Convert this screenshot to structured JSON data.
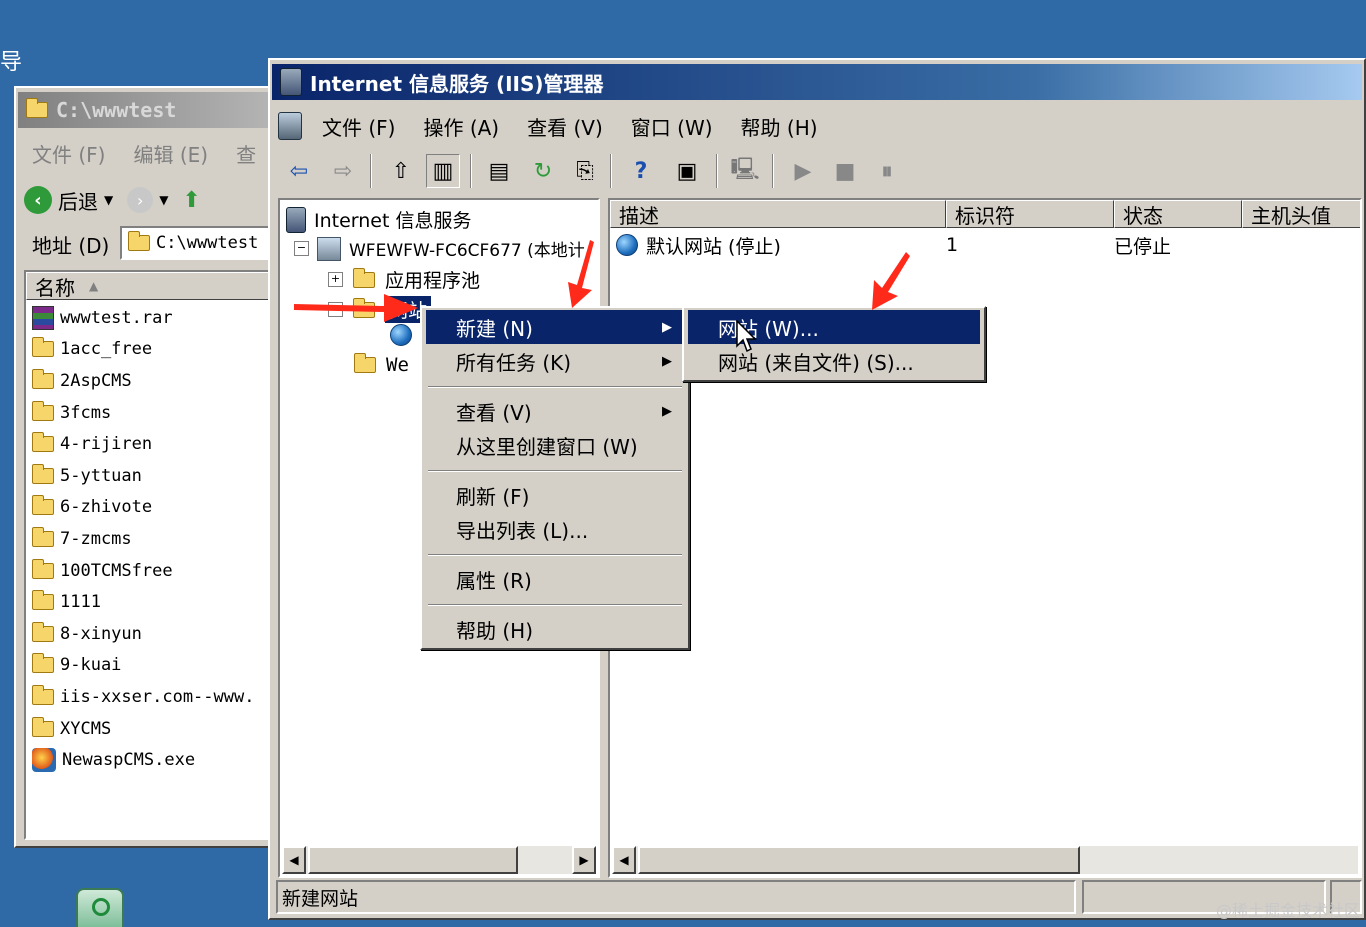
{
  "desktop": {
    "left_edge_text": "导"
  },
  "explorer": {
    "title": "C:\\wwwtest",
    "menu": [
      "文件 (F)",
      "编辑 (E)",
      "查"
    ],
    "back_label": "后退",
    "address_label": "地址 (D)",
    "address_value": "C:\\wwwtest",
    "column_name": "名称",
    "files": [
      {
        "name": "wwwtest.rar",
        "type": "rar"
      },
      {
        "name": "1acc_free",
        "type": "folder"
      },
      {
        "name": "2AspCMS",
        "type": "folder"
      },
      {
        "name": "3fcms",
        "type": "folder"
      },
      {
        "name": "4-rijiren",
        "type": "folder"
      },
      {
        "name": "5-yttuan",
        "type": "folder"
      },
      {
        "name": "6-zhivote",
        "type": "folder"
      },
      {
        "name": "7-zmcms",
        "type": "folder"
      },
      {
        "name": "100TCMSfree",
        "type": "folder"
      },
      {
        "name": "1111",
        "type": "folder"
      },
      {
        "name": "8-xinyun",
        "type": "folder"
      },
      {
        "name": "9-kuai",
        "type": "folder"
      },
      {
        "name": "iis-xxser.com--www.",
        "type": "folder"
      },
      {
        "name": "XYCMS",
        "type": "folder"
      },
      {
        "name": "NewaspCMS.exe",
        "type": "exe"
      }
    ]
  },
  "iis": {
    "title": "Internet 信息服务 (IIS)管理器",
    "menu": [
      "文件 (F)",
      "操作 (A)",
      "查看 (V)",
      "窗口 (W)",
      "帮助 (H)"
    ],
    "tree": {
      "root": "Internet 信息服务",
      "server": "WFEWFW-FC6CF677 (本地计",
      "app_pools": "应用程序池",
      "websites": "网站",
      "web_ext": "We"
    },
    "list_columns": [
      "描述",
      "标识符",
      "状态",
      "主机头值"
    ],
    "list_rows": [
      {
        "desc": "默认网站 (停止)",
        "id": "1",
        "status": "已停止",
        "host": ""
      }
    ],
    "status_text": "新建网站"
  },
  "context_menu": {
    "items": [
      "新建 (N)",
      "所有任务 (K)",
      "查看 (V)",
      "从这里创建窗口 (W)",
      "刷新 (F)",
      "导出列表 (L)...",
      "属性 (R)",
      "帮助 (H)"
    ]
  },
  "submenu": {
    "items": [
      "网站 (W)...",
      "网站 (来自文件) (S)..."
    ]
  },
  "watermark": "@稀土掘金技术社区",
  "colors": {
    "title_active": "#0a246a",
    "title_inactive": "#808080",
    "desktop": "#2f6aa6",
    "selection": "#0a246a",
    "arrow": "#ff2a1a"
  }
}
